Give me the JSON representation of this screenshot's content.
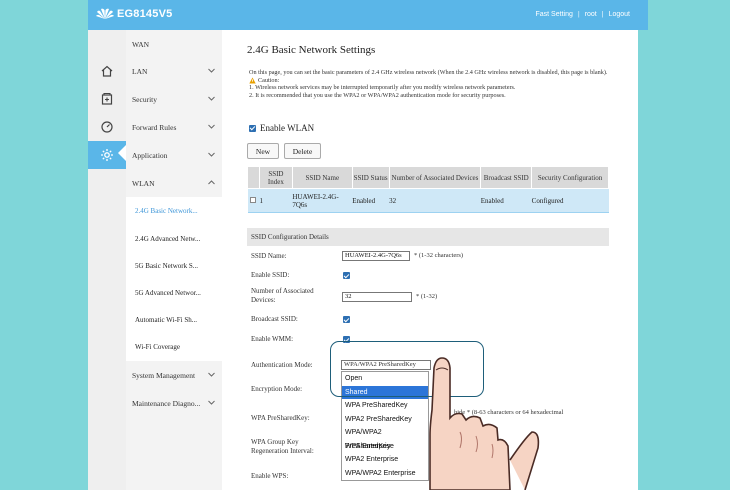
{
  "app": {
    "brand": "EG8145V5",
    "top_links": [
      "Fast Setting",
      "root",
      "Logout"
    ]
  },
  "menu": {
    "items": [
      {
        "label": "WAN"
      },
      {
        "label": "LAN"
      },
      {
        "label": "Security"
      },
      {
        "label": "Forward Rules"
      },
      {
        "label": "Application"
      },
      {
        "label": "WLAN"
      }
    ],
    "wlan_sub": [
      {
        "label": "2.4G Basic Network..."
      },
      {
        "label": "2.4G Advanced Netw..."
      },
      {
        "label": "5G Basic Network S..."
      },
      {
        "label": "5G Advanced Networ..."
      },
      {
        "label": "Automatic Wi-Fi Sh..."
      },
      {
        "label": "Wi-Fi Coverage"
      }
    ],
    "bottom": [
      {
        "label": "System Management"
      },
      {
        "label": "Maintenance Diagno..."
      }
    ]
  },
  "page": {
    "title": "2.4G Basic Network Settings",
    "desc1": "On this page, you can set the basic parameters of 2.4 GHz wireless network (When the 2.4 GHz wireless network is disabled, this page is blank).",
    "caution_label": "Caution:",
    "caution1": "1. Wireless network services may be interrupted temporarily after you modify wireless network parameters.",
    "caution2": "2. It is recommended that you use the WPA2 or WPA/WPA2 authentication mode for security purposes.",
    "enable_wlan": "Enable WLAN",
    "new_btn": "New",
    "delete_btn": "Delete"
  },
  "table": {
    "headers": [
      "SSID Index",
      "SSID Name",
      "SSID Status",
      "Number of Associated Devices",
      "Broadcast SSID",
      "Security Configuration"
    ],
    "row": [
      "1",
      "HUAWEI-2.4G-7Q6s",
      "Enabled",
      "32",
      "Enabled",
      "Configured"
    ]
  },
  "config": {
    "section_title": "SSID Configuration Details",
    "ssid_name_label": "SSID Name:",
    "ssid_name_value": "HUAWEI-2.4G-7Q6s",
    "ssid_name_hint": "* (1-32 characters)",
    "enable_ssid_label": "Enable SSID:",
    "assoc_label": "Number of Associated Devices:",
    "assoc_value": "32",
    "assoc_hint": "* (1-32)",
    "broadcast_label": "Broadcast SSID:",
    "wmm_label": "Enable WMM:",
    "auth_label": "Authentication Mode:",
    "auth_value": "WPA/WPA2 PreSharedKey",
    "enc_label": "Encryption Mode:",
    "psk_label": "WPA PreSharedKey:",
    "psk_hint": "hide * (8-63 characters or 64 hexadecimal",
    "group_key_label": "WPA Group Key Regeneration Interval:",
    "wps_label": "Enable WPS:"
  },
  "dropdown": {
    "options": [
      "Open",
      "Shared",
      "WPA PreSharedKey",
      "WPA2 PreSharedKey",
      "WPA/WPA2 PreSharedKey",
      "WPA Enterprise",
      "WPA2 Enterprise",
      "WPA/WPA2 Enterprise"
    ],
    "selected": "Shared"
  },
  "colors": {
    "accent": "#5ab6e8",
    "selected_option": "#2c75d8",
    "highlight_ring": "#1e5e7a"
  }
}
